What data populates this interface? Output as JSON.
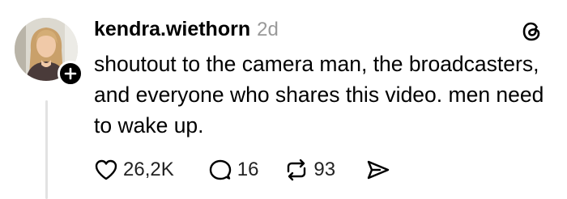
{
  "post": {
    "username": "kendra.wiethorn",
    "time": "2d",
    "text": "shoutout to the camera man, the broadcasters, and everyone who shares this video. men need to wake up.",
    "likes": "26,2K",
    "replies": "16",
    "reposts": "93"
  },
  "icons": {
    "avatar": "profile-photo",
    "follow": "plus-icon",
    "brand": "threads-logo-icon",
    "like": "heart-icon",
    "reply": "speech-bubble-icon",
    "repost": "repost-arrows-icon",
    "share": "send-icon"
  },
  "colors": {
    "background": "#ffffff",
    "text": "#000000",
    "muted": "#999999",
    "thread_line": "#e2e2e2"
  }
}
